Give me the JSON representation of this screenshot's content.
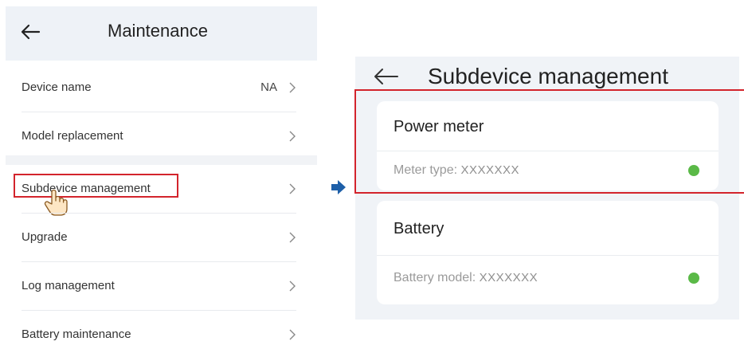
{
  "left_screen": {
    "title": "Maintenance",
    "items": [
      {
        "label": "Device name",
        "value": "NA"
      },
      {
        "label": "Model replacement",
        "value": ""
      },
      {
        "label": "Subdevice management",
        "value": ""
      },
      {
        "label": "Upgrade",
        "value": ""
      },
      {
        "label": "Log management",
        "value": ""
      },
      {
        "label": "Battery maintenance",
        "value": ""
      }
    ],
    "highlighted_item": "Subdevice management"
  },
  "right_screen": {
    "title": "Subdevice management",
    "cards": [
      {
        "title": "Power meter",
        "field_label": "Meter type:",
        "field_value": "XXXXXXX",
        "status_color": "#5ab947"
      },
      {
        "title": "Battery",
        "field_label": "Battery model:",
        "field_value": "XXXXXXX",
        "status_color": "#5ab947"
      }
    ]
  },
  "colors": {
    "highlight": "#d3242c",
    "flow_arrow": "#1d5fa8",
    "status_ok": "#5ab947"
  },
  "icons": {
    "back": "arrow-left-icon",
    "chevron": "chevron-right-icon",
    "pointer": "hand-pointer-icon",
    "flow": "arrow-right-icon"
  }
}
